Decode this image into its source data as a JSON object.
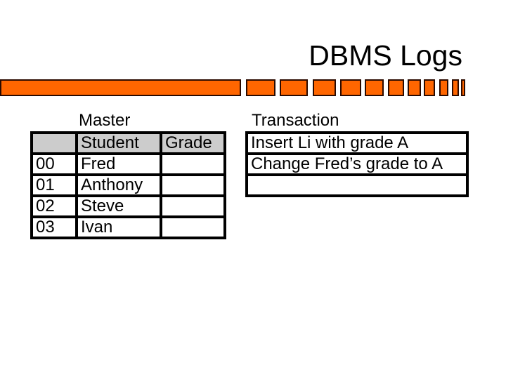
{
  "slide": {
    "title": "DBMS Logs",
    "accent_color": "#ff6600",
    "bar_border_color": "#2a0a00"
  },
  "master": {
    "label": "Master",
    "columns": [
      "",
      "Student",
      "Grade"
    ],
    "rows": [
      {
        "id": "00",
        "student": "Fred",
        "grade": ""
      },
      {
        "id": "01",
        "student": "Anthony",
        "grade": ""
      },
      {
        "id": "02",
        "student": "Steve",
        "grade": ""
      },
      {
        "id": "03",
        "student": "Ivan",
        "grade": ""
      }
    ]
  },
  "transaction": {
    "label": "Transaction",
    "rows": [
      "Insert Li with grade A",
      "Change Fred’s grade to A",
      ""
    ]
  }
}
